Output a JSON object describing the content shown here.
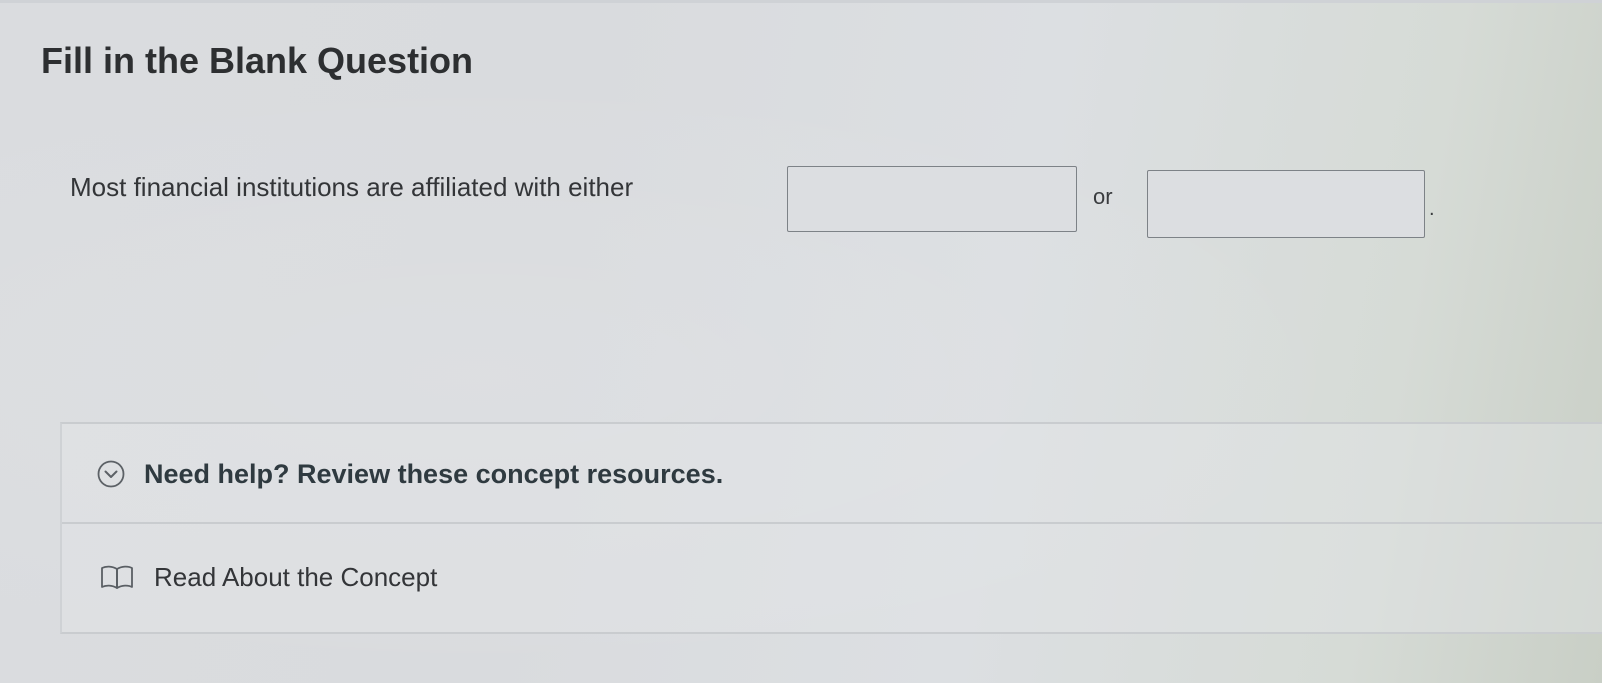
{
  "page": {
    "title": "Fill in the Blank Question"
  },
  "question": {
    "prompt": "Most financial institutions are affiliated with either",
    "connector": "or",
    "end_punctuation": ".",
    "blank_1": {
      "value": "",
      "placeholder": ""
    },
    "blank_2": {
      "value": "",
      "placeholder": ""
    }
  },
  "help": {
    "toggle_label": "Need help? Review these concept resources.",
    "toggle_icon": "chevron-down-circle-icon",
    "resources": [
      {
        "label": "Read About the Concept",
        "icon": "book-icon"
      }
    ]
  }
}
